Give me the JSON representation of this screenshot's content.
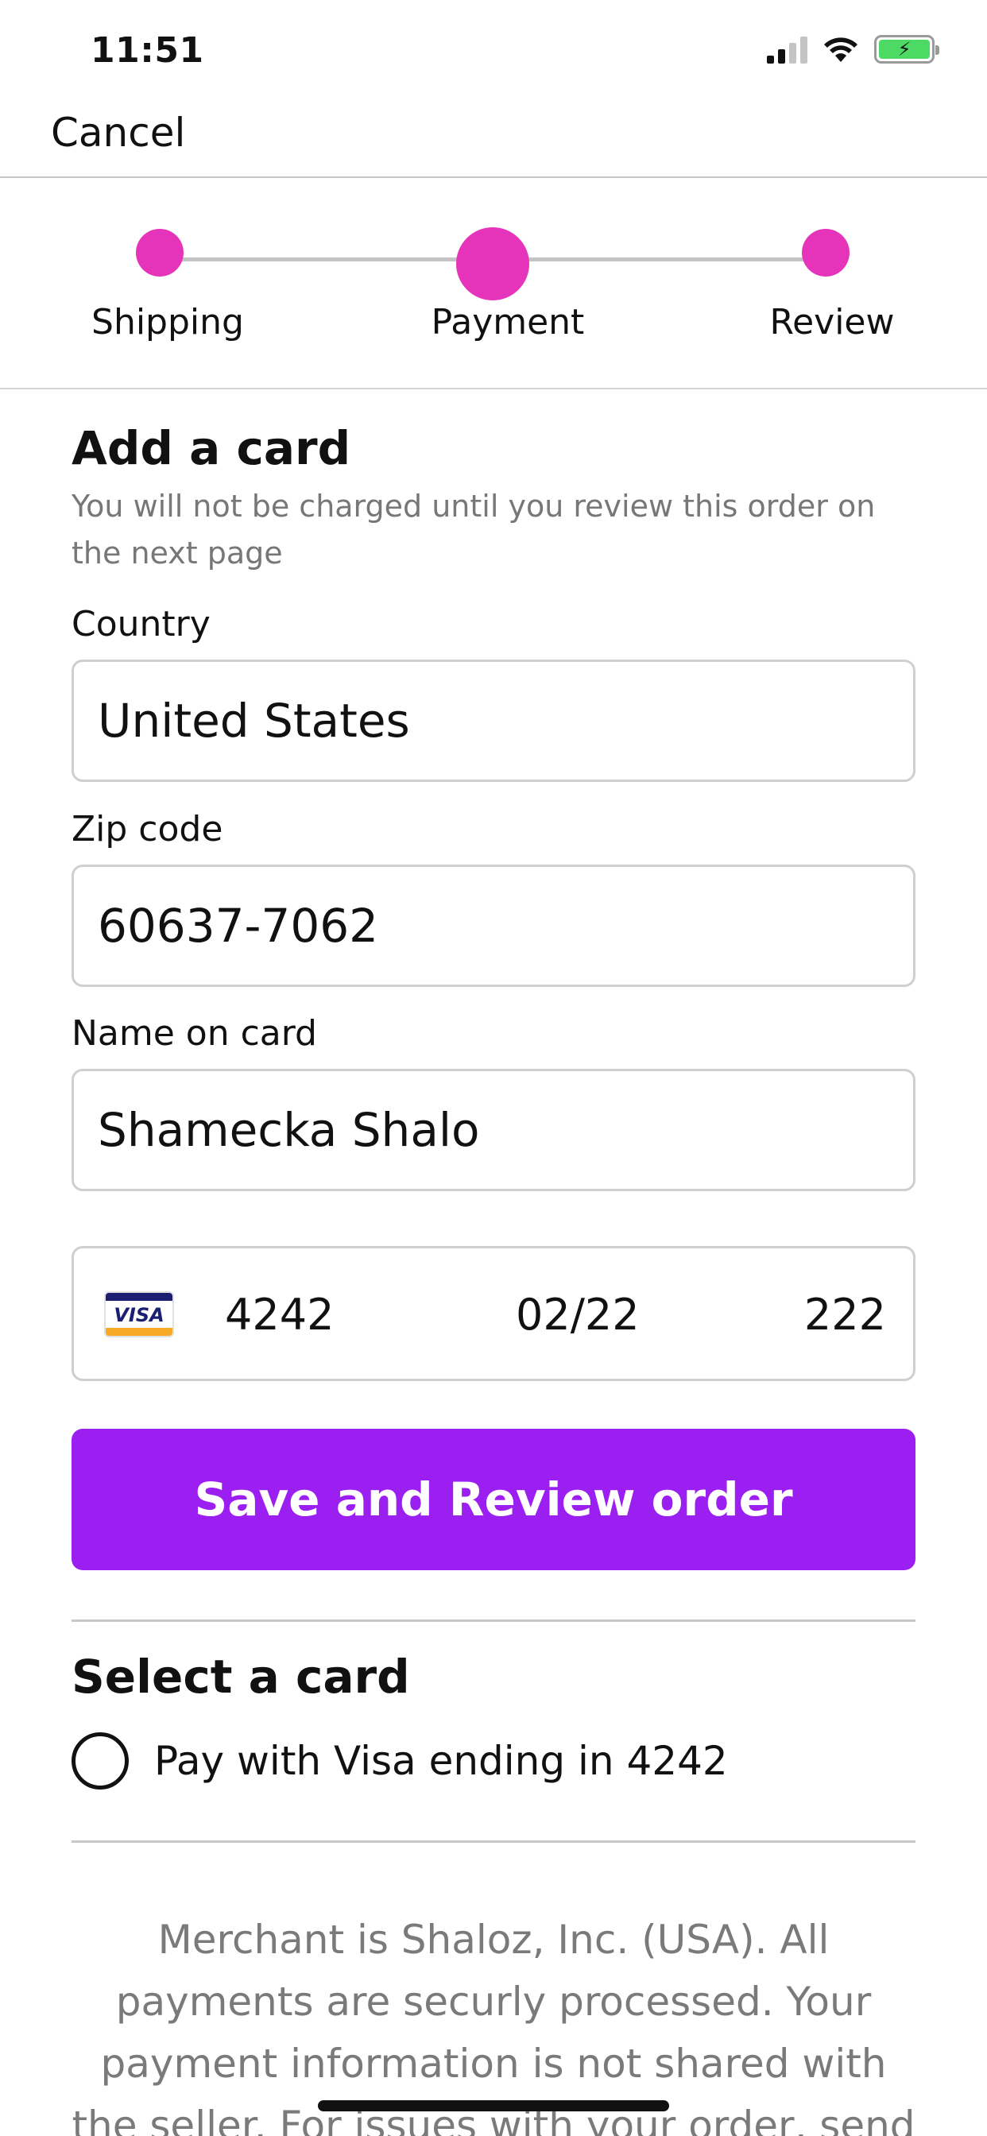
{
  "status_bar": {
    "time": "11:51",
    "icons": [
      "signal-icon",
      "wifi-icon",
      "battery-charging-icon"
    ]
  },
  "nav": {
    "cancel_label": "Cancel"
  },
  "stepper": {
    "steps": [
      {
        "label": "Shipping",
        "state": "complete"
      },
      {
        "label": "Payment",
        "state": "current"
      },
      {
        "label": "Review",
        "state": "upcoming"
      }
    ],
    "accent_color": "#e534b9"
  },
  "form": {
    "title": "Add a card",
    "subtitle": "You will not be charged until you review this order on the next page",
    "country_label": "Country",
    "country_value": "United States",
    "zip_label": "Zip code",
    "zip_value": "60637-7062",
    "name_label": "Name on card",
    "name_value": "Shamecka Shalo",
    "card": {
      "brand": "VISA",
      "number": "4242",
      "expiry": "02/22",
      "cvc": "222"
    },
    "save_label": "Save and Review order",
    "button_color": "#9b1ff0"
  },
  "select_card": {
    "title": "Select a card",
    "option_label": "Pay with Visa ending in 4242"
  },
  "merchant_text": "Merchant is Shaloz, Inc. (USA). All payments are securly processed. Your payment information is not shared with the seller. For issues with your order, send"
}
